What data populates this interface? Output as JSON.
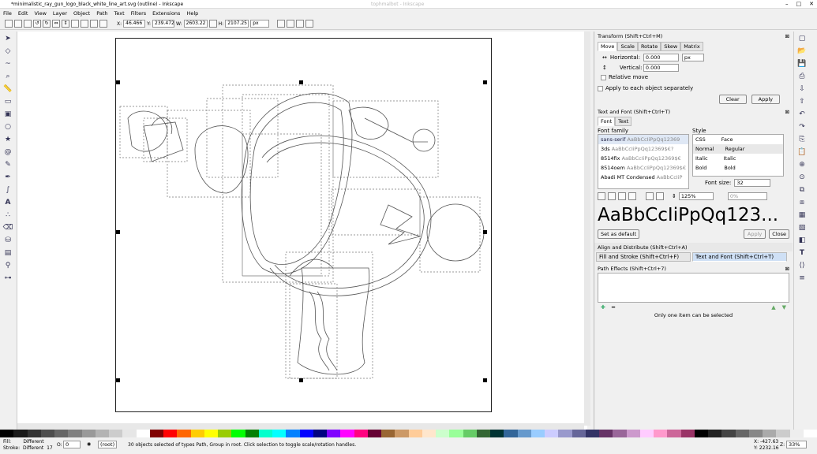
{
  "title": "*minimalistic_ray_gun_logo_black_white_line_art.svg (outline) - Inkscape",
  "ghost_title": "tophmalbot - Inkscape",
  "menu": [
    "File",
    "Edit",
    "View",
    "Layer",
    "Object",
    "Path",
    "Text",
    "Filters",
    "Extensions",
    "Help"
  ],
  "toolbar": {
    "x_label": "X:",
    "x": "46.466",
    "y_label": "Y:",
    "y": "239.472",
    "w_label": "W:",
    "w": "2603.22",
    "h_label": "H:",
    "h": "2107.25",
    "unit": "px"
  },
  "transform": {
    "title": "Transform (Shift+Ctrl+M)",
    "tabs": [
      "Move",
      "Scale",
      "Rotate",
      "Skew",
      "Matrix"
    ],
    "horizontal_label": "Horizontal:",
    "horizontal": "0.000",
    "unit": "px",
    "vertical_label": "Vertical:",
    "vertical": "0.000",
    "relative_label": "Relative move",
    "apply_each_label": "Apply to each object separately",
    "clear_label": "Clear",
    "apply_label": "Apply"
  },
  "text_font": {
    "title": "Text and Font (Shift+Ctrl+T)",
    "tabs": [
      "Font",
      "Text"
    ],
    "family_header": "Font family",
    "style_header": "Style",
    "families": [
      {
        "name": "sans-serif",
        "sample": "AaBbCcIiPpQq12369"
      },
      {
        "name": "3ds",
        "sample": "AaBbCcIiPpQq12369$€?"
      },
      {
        "name": "8514fix",
        "sample": "AaBbCcIiPpQq12369$€"
      },
      {
        "name": "8514oem",
        "sample": "AaBbCcIiPpQq12369$€"
      },
      {
        "name": "Abadi MT Condensed",
        "sample": "AaBbCcIiP"
      }
    ],
    "style_cols": [
      "CSS",
      "Face"
    ],
    "styles": [
      [
        "Normal",
        "Regular"
      ],
      [
        "Italic",
        "Italic"
      ],
      [
        "Bold",
        "Bold"
      ]
    ],
    "line_spacing": "125%",
    "font_size_label": "Font size:",
    "font_size": "32",
    "kerning": "0%",
    "preview": "AaBbCcIiPpQq123...",
    "set_default_label": "Set as default",
    "apply_label": "Apply",
    "close_label": "Close"
  },
  "align_title": "Align and Distribute (Shift+Ctrl+A)",
  "fill_stroke_tab": "Fill and Stroke (Shift+Ctrl+F)",
  "text_font_tab": "Text and Font (Shift+Ctrl+T)",
  "path_effects": {
    "title": "Path Effects  (Shift+Ctrl+7)",
    "message": "Only one item can be selected"
  },
  "status": {
    "fill_label": "Fill:",
    "fill": "Different",
    "stroke_label": "Stroke:",
    "stroke": "Different",
    "stroke_width": "17",
    "opacity_label": "O:",
    "opacity": "0",
    "layer": "(root)",
    "message": "30 objects selected of types Path, Group in root. Click selection to toggle scale/rotation handles.",
    "x": "X: -427.63",
    "y": "Y: 2232.16",
    "zoom_label": "Z:",
    "zoom": "33%"
  },
  "palette": [
    "#000000",
    "#1a1a1a",
    "#333333",
    "#4d4d4d",
    "#666666",
    "#808080",
    "#999999",
    "#b3b3b3",
    "#cccccc",
    "#e6e6e6",
    "#ffffff",
    "#800000",
    "#ff0000",
    "#ff6600",
    "#ffcc00",
    "#ffff00",
    "#99cc00",
    "#00ff00",
    "#008000",
    "#00ffcc",
    "#00ffff",
    "#0080ff",
    "#0000ff",
    "#000080",
    "#8000ff",
    "#ff00ff",
    "#ff0080",
    "#660033",
    "#996633",
    "#cc9966",
    "#ffcc99",
    "#ffe6cc",
    "#ccffcc",
    "#99ff99",
    "#66cc66",
    "#336633",
    "#003333",
    "#336699",
    "#6699cc",
    "#99ccff",
    "#ccccff",
    "#9999cc",
    "#666699",
    "#333366",
    "#663366",
    "#996699",
    "#cc99cc",
    "#ffccff",
    "#ff99cc",
    "#cc6699",
    "#993366",
    "#000000",
    "#222222",
    "#444444",
    "#666666",
    "#888888",
    "#aaaaaa",
    "#cccccc",
    "#eeeeee",
    "#ffffff"
  ]
}
